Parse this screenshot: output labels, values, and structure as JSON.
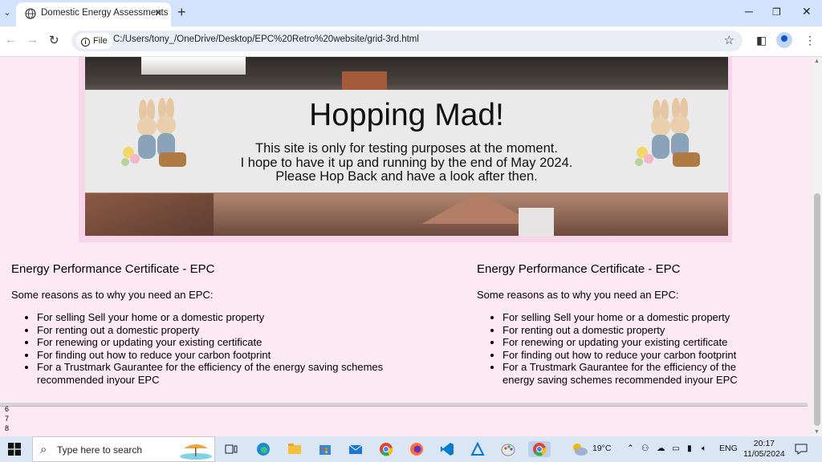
{
  "browser": {
    "tab_title": "Domestic Energy Assessments",
    "omnibox_chip": "File",
    "url": "C:/Users/tony_/OneDrive/Desktop/EPC%20Retro%20website/grid-3rd.html"
  },
  "banner": {
    "heading": "Hopping Mad!",
    "line1": "This site is only for testing purposes at the moment.",
    "line2": "I hope to have it up and running by the end of May 2024.",
    "line3": "Please Hop Back and have a look after then."
  },
  "columns": [
    {
      "heading": "Energy Performance Certificate - EPC",
      "subheading": "Some reasons as to why you need an EPC:",
      "items": [
        "For selling Sell your home or a domestic property",
        "For renting out a domestic property",
        "For renewing or updating your existing certificate",
        "For finding out how to reduce your carbon footprint",
        "For a Trustmark Gaurantee for the efficiency of the energy saving schemes recommended inyour EPC"
      ]
    },
    {
      "heading": "Energy Performance Certificate - EPC",
      "subheading": "Some reasons as to why you need an EPC:",
      "items": [
        "For selling Sell your home or a domestic property",
        "For renting out a domestic property",
        "For renewing or updating your existing certificate",
        "For finding out how to reduce your carbon footprint",
        "For a Trustmark Gaurantee for the efficiency of the energy saving schemes recommended inyour EPC"
      ]
    }
  ],
  "footer_numbers": [
    "6",
    "7",
    "8"
  ],
  "taskbar": {
    "search_placeholder": "Type here to search",
    "weather": "19°C",
    "language": "ENG",
    "time": "20:17",
    "date": "11/05/2024"
  },
  "colors": {
    "page_background": "#fde9f3",
    "hero_frame": "#f9d5ea",
    "banner_background": "#eaeaea",
    "tabstrip": "#d3e3fd"
  }
}
